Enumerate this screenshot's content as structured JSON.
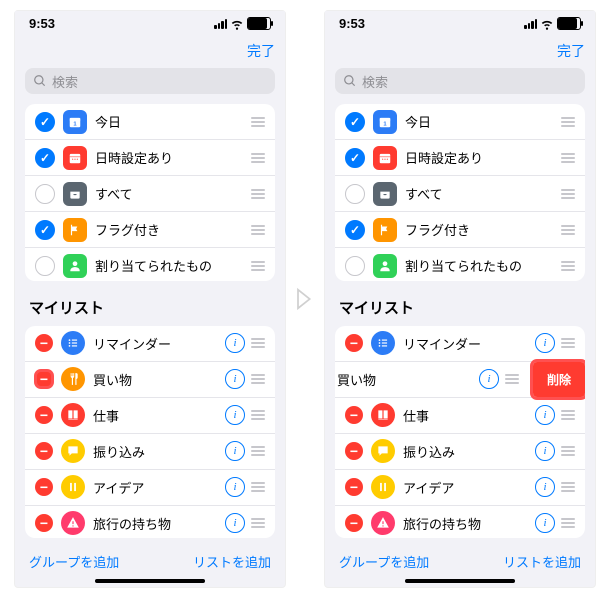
{
  "status": {
    "time": "9:53"
  },
  "nav": {
    "done": "完了"
  },
  "search": {
    "placeholder": "検索"
  },
  "smart": [
    {
      "checked": true,
      "color": "#2c7cf6",
      "icon": "calendar-today",
      "label": "今日"
    },
    {
      "checked": true,
      "color": "#ff3b30",
      "icon": "calendar",
      "label": "日時設定あり"
    },
    {
      "checked": false,
      "color": "#5b6670",
      "icon": "tray",
      "label": "すべて"
    },
    {
      "checked": true,
      "color": "#ff9500",
      "icon": "flag",
      "label": "フラグ付き"
    },
    {
      "checked": false,
      "color": "#30d158",
      "icon": "person",
      "label": "割り当てられたもの"
    }
  ],
  "mylist": {
    "title": "マイリスト"
  },
  "lists": [
    {
      "color": "#2c7cf6",
      "icon": "list",
      "label": "リマインダー"
    },
    {
      "color": "#ff9500",
      "icon": "fork",
      "label": "買い物"
    },
    {
      "color": "#ff3b30",
      "icon": "book",
      "label": "仕事"
    },
    {
      "color": "#ffcc00",
      "icon": "chat",
      "label": "振り込み"
    },
    {
      "color": "#ffcc00",
      "icon": "pause",
      "label": "アイデア"
    },
    {
      "color": "#ff3b6c",
      "icon": "alert",
      "label": "旅行の持ち物"
    }
  ],
  "bottom": {
    "addGroup": "グループを追加",
    "addList": "リストを追加"
  },
  "delete": {
    "label": "削除"
  }
}
